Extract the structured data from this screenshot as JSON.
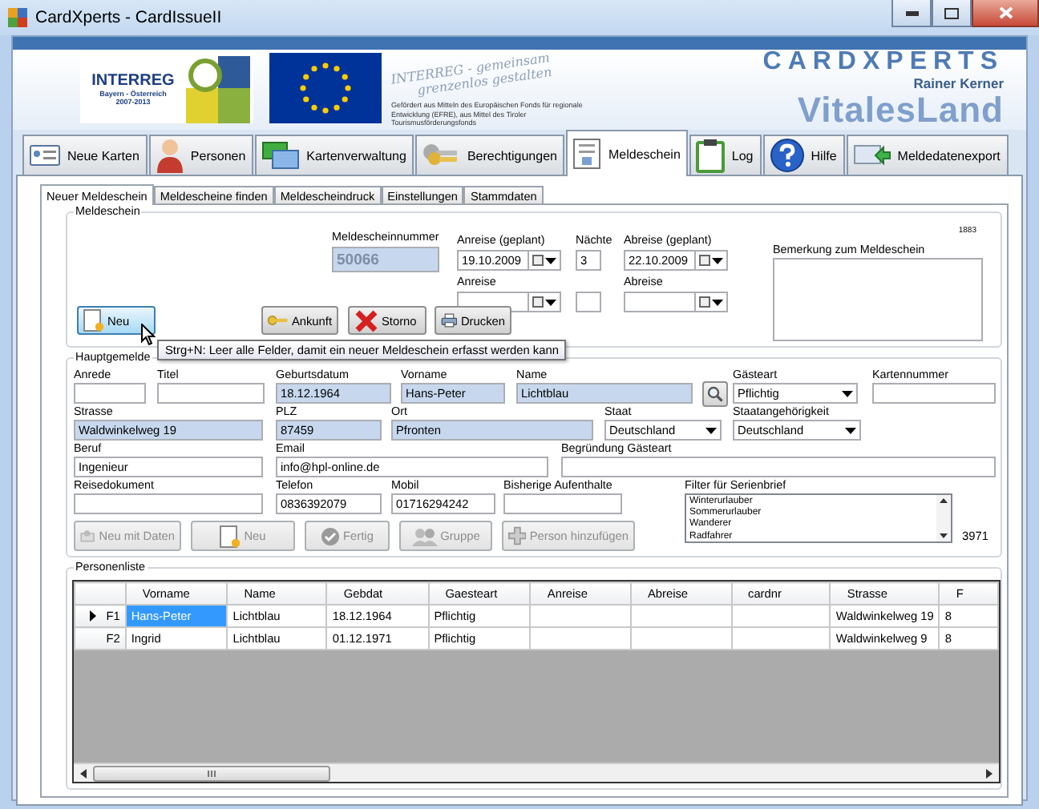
{
  "window": {
    "title": "CardXperts - CardIssueII"
  },
  "banner": {
    "interreg": "INTERREG",
    "region": "Bayern - Österreich",
    "period": "2007-2013",
    "slogan": [
      "INTERREG - gemeinsam",
      "grenzenlos gestalten"
    ],
    "funding": "Gefördert aus Mitteln des Europäischen Fonds für regionale Entwicklung (EFRE), aus Mittel des Tiroler Tourismusförderungsfonds",
    "brand": "CARDXPERTS",
    "brand_sub": "Rainer Kerner",
    "product": "VitalesLand"
  },
  "tabs": [
    {
      "label": "Neue Karten",
      "kind": "cards",
      "selected": false
    },
    {
      "label": "Personen",
      "kind": "person",
      "selected": false
    },
    {
      "label": "Kartenverwaltung",
      "kind": "windows",
      "selected": false
    },
    {
      "label": "Berechtigungen",
      "kind": "keys",
      "selected": false
    },
    {
      "label": "Meldeschein",
      "kind": "form",
      "selected": true
    },
    {
      "label": "Log",
      "kind": "clipboard",
      "selected": false
    },
    {
      "label": "Hilfe",
      "kind": "help",
      "selected": false
    },
    {
      "label": "Meldedatenexport",
      "kind": "export",
      "selected": false
    }
  ],
  "subtabs": [
    {
      "label": "Neuer Meldeschein",
      "selected": true
    },
    {
      "label": "Meldescheine finden",
      "selected": false
    },
    {
      "label": "Meldescheindruck",
      "selected": false
    },
    {
      "label": "Einstellungen",
      "selected": false
    },
    {
      "label": "Stammdaten",
      "selected": false
    }
  ],
  "meldeschein": {
    "title": "Meldeschein",
    "number_label": "Meldescheinnummer",
    "number": "50066",
    "counter": "1883",
    "arrival_planned": {
      "label": "Anreise (geplant)",
      "value": "19.10.2009"
    },
    "nights": {
      "label": "Nächte",
      "value": "3"
    },
    "departure_planned": {
      "label": "Abreise (geplant)",
      "value": "22.10.2009"
    },
    "arrival": {
      "label": "Anreise"
    },
    "departure": {
      "label": "Abreise"
    },
    "remark_label": "Bemerkung zum Meldeschein",
    "buttons": [
      {
        "label": "Neu",
        "kind": "new",
        "hovered": true
      },
      {
        "label": "Ankunft",
        "kind": "key",
        "hovered": false
      },
      {
        "label": "Storno",
        "kind": "cancel",
        "hovered": false
      },
      {
        "label": "Drucken",
        "kind": "print",
        "hovered": false
      }
    ]
  },
  "tooltip": "Strg+N: Leer alle Felder, damit ein neuer Meldeschein erfasst werden kann",
  "guest": {
    "title": "Hauptgemelde",
    "rows": [
      {
        "fields": [
          {
            "kind": "text",
            "label": "Anrede",
            "highlighted": false
          },
          {
            "kind": "text",
            "label": "Titel",
            "highlighted": false
          },
          {
            "kind": "text",
            "label": "Geburtsdatum",
            "value": "18.12.1964",
            "highlighted": true
          },
          {
            "kind": "text",
            "label": "Vorname",
            "value": "Hans-Peter",
            "highlighted": true
          },
          {
            "kind": "text",
            "label": "Name",
            "value": "Lichtblau",
            "highlighted": true
          },
          {
            "kind": "search"
          },
          {
            "kind": "combo",
            "label": "Gästeart",
            "value": "Pflichtig",
            "highlighted": false
          },
          {
            "kind": "text",
            "label": "Kartennummer",
            "highlighted": false
          }
        ]
      },
      {
        "fields": [
          {
            "kind": "text",
            "label": "Strasse",
            "value": "Waldwinkelweg 19",
            "highlighted": true
          },
          {
            "kind": "text",
            "label": "PLZ",
            "value": "87459",
            "highlighted": true
          },
          {
            "kind": "text",
            "label": "Ort",
            "value": "Pfronten",
            "highlighted": true
          },
          {
            "kind": "combo",
            "label": "Staat",
            "value": "Deutschland",
            "highlighted": false
          },
          {
            "kind": "combo",
            "label": "Staatangehörigkeit",
            "value": "Deutschland",
            "highlighted": false
          }
        ]
      },
      {
        "fields": [
          {
            "kind": "text",
            "label": "Beruf",
            "value": "Ingenieur",
            "highlighted": false
          },
          {
            "kind": "text",
            "label": "Email",
            "value": "info@hpl-online.de",
            "highlighted": false
          },
          {
            "kind": "text",
            "label": "Begründung Gästeart",
            "highlighted": false
          }
        ]
      },
      {
        "fields": [
          {
            "kind": "text",
            "label": "Reisedokument",
            "highlighted": false
          },
          {
            "kind": "text",
            "label": "Telefon",
            "value": "0836392079",
            "highlighted": false
          },
          {
            "kind": "text",
            "label": "Mobil",
            "value": "01716294242",
            "highlighted": false
          },
          {
            "kind": "text",
            "label": "Bisherige Aufenthalte",
            "highlighted": false
          }
        ]
      }
    ],
    "filter": {
      "label": "Filter für Serienbrief",
      "items": [
        "Winterurlauber",
        "Sommerurlauber",
        "Wanderer",
        "Radfahrer"
      ],
      "count": "3971"
    },
    "buttons": [
      {
        "label": "Neu mit Daten",
        "kind": "copy",
        "disabled": true
      },
      {
        "label": "Neu",
        "kind": "new",
        "disabled": true
      },
      {
        "label": "Fertig",
        "kind": "done",
        "disabled": true
      },
      {
        "label": "Gruppe",
        "kind": "group",
        "disabled": true
      },
      {
        "label": "Person hinzufügen",
        "kind": "add",
        "disabled": true
      }
    ]
  },
  "persons": {
    "title": "Personenliste",
    "columns": [
      "Vorname",
      "Name",
      "Gebdat",
      "Gaesteart",
      "Anreise",
      "Abreise",
      "cardnr",
      "Strasse",
      "F"
    ],
    "rows": [
      {
        "header": "F1",
        "selected": true,
        "cells": [
          "Hans-Peter",
          "Lichtblau",
          "18.12.1964",
          "Pflichtig",
          "",
          "",
          "",
          "Waldwinkelweg 19",
          "8"
        ]
      },
      {
        "header": "F2",
        "selected": false,
        "cells": [
          "Ingrid",
          "Lichtblau",
          "01.12.1971",
          "Pflichtig",
          "",
          "",
          "",
          "Waldwinkelweg 9",
          "8"
        ]
      }
    ]
  }
}
